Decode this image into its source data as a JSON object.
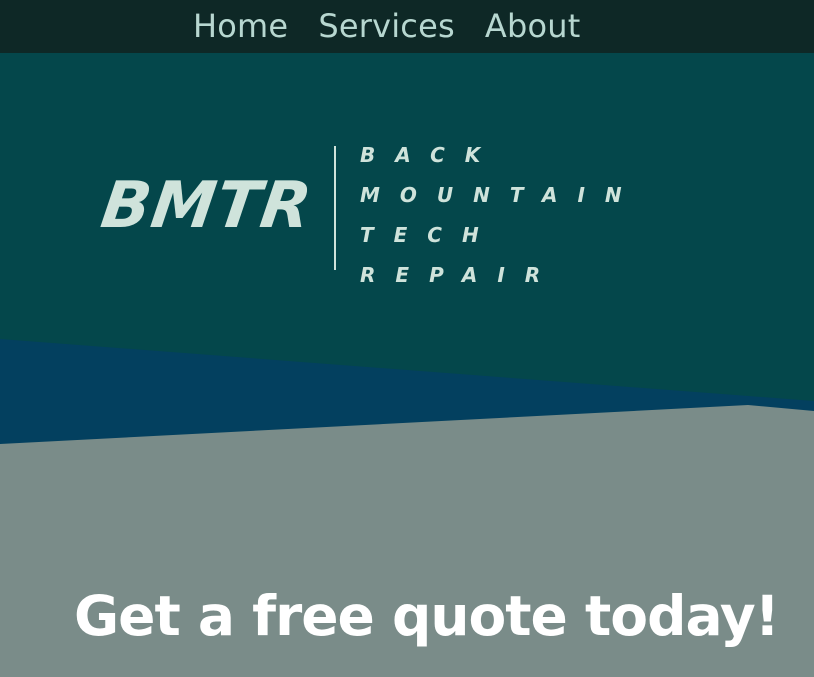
{
  "nav": {
    "items": [
      {
        "label": "Home"
      },
      {
        "label": "Services"
      },
      {
        "label": "About"
      }
    ]
  },
  "logo": {
    "mark": "BMTR",
    "words": [
      "BACK",
      "MOUNTAIN",
      "TECH",
      "REPAIR"
    ]
  },
  "cta": {
    "text": "Get a free quote today!"
  },
  "colors": {
    "nav_bg": "#0e2826",
    "nav_text": "#b7d7d0",
    "hero_bg": "#04474b",
    "band_blue": "#03405f",
    "band_grey": "#7a8c89",
    "logo_text": "#cfe3db",
    "cta_text": "#ffffff"
  }
}
